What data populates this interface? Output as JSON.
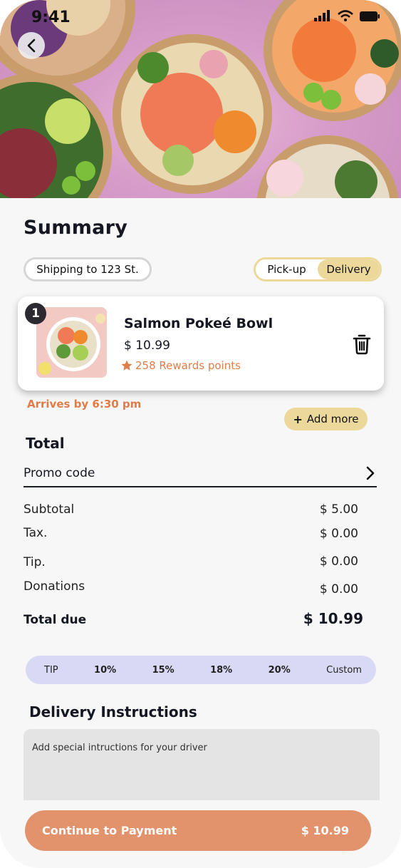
{
  "status_bar": {
    "time": "9:41"
  },
  "summary": {
    "title": "Summary"
  },
  "shipping": {
    "label": "Shipping to 123 St."
  },
  "mode_toggle": {
    "options": [
      "Pick-up",
      "Delivery"
    ],
    "selected": "Delivery"
  },
  "cart_item": {
    "quantity": "1",
    "name": "Salmon Pokeé Bowl",
    "price": "$ 10.99",
    "rewards": "258 Rewards points"
  },
  "arrival": "Arrives by 6:30 pm",
  "add_more": "Add more",
  "totals": {
    "heading": "Total",
    "promo_label": "Promo code",
    "rows": [
      {
        "label": "Subtotal",
        "value": "$ 5.00"
      },
      {
        "label": "Tax.",
        "value": "$ 0.00"
      },
      {
        "label": "Tip.",
        "value": "$ 0.00"
      },
      {
        "label": "Donations",
        "value": "$ 0.00"
      }
    ],
    "due_label": "Total due",
    "due_value": "$ 10.99"
  },
  "tip_options": [
    "TIP",
    "10%",
    "15%",
    "18%",
    "20%",
    "Custom"
  ],
  "delivery": {
    "heading": "Delivery Instructions",
    "placeholder": "Add special intructions for your driver"
  },
  "checkout": {
    "label": "Continue to Payment",
    "amount": "$ 10.99"
  },
  "colors": {
    "accent": "#e2936c",
    "toggle": "#ecd89a",
    "tip_bar": "#d9d9f6",
    "rewards": "#e07c48"
  }
}
